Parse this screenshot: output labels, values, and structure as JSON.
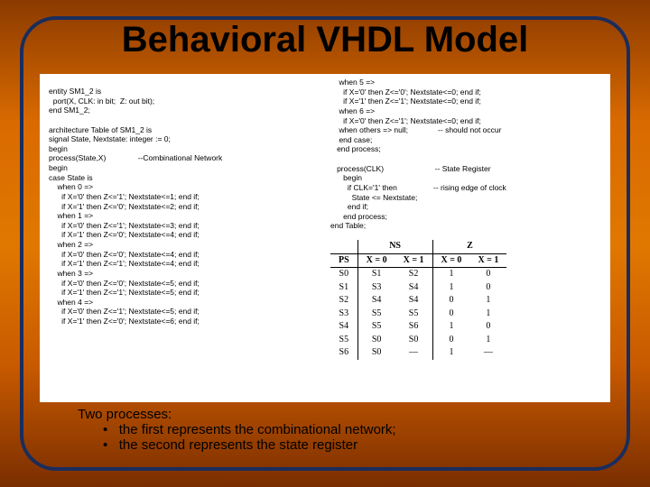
{
  "title": "Behavioral VHDL Model",
  "left_code": "entity SM1_2 is\n  port(X, CLK: in bit;  Z: out bit);\nend SM1_2;\n\narchitecture Table of SM1_2 is\nsignal State, Nextstate: integer := 0;\nbegin\nprocess(State,X)               --Combinational Network\nbegin\ncase State is\n    when 0 =>\n      if X='0' then Z<='1'; Nextstate<=1; end if;\n      if X='1' then Z<='0'; Nextstate<=2; end if;\n    when 1 =>\n      if X='0' then Z<='1'; Nextstate<=3; end if;\n      if X='1' then Z<='0'; Nextstate<=4; end if;\n    when 2 =>\n      if X='0' then Z<='0'; Nextstate<=4; end if;\n      if X='1' then Z<='1'; Nextstate<=4; end if;\n    when 3 =>\n      if X='0' then Z<='0'; Nextstate<=5; end if;\n      if X='1' then Z<='1'; Nextstate<=5; end if;\n    when 4 =>\n      if X='0' then Z<='1'; Nextstate<=5; end if;\n      if X='1' then Z<='0'; Nextstate<=6; end if;",
  "right_code": "    when 5 =>\n      if X='0' then Z<='0'; Nextstate<=0; end if;\n      if X='1' then Z<='1'; Nextstate<=0; end if;\n    when 6 =>\n      if X='0' then Z<='1'; Nextstate<=0; end if;\n    when others => null;              -- should not occur\n    end case;\n   end process;\n\n   process(CLK)                        -- State Register\n      begin\n        if CLK='1' then                 -- rising edge of clock\n          State <= Nextstate;\n        end if;\n      end process;\nend Table;",
  "table": {
    "head_ns": "NS",
    "head_z": "Z",
    "ps": "PS",
    "cols": [
      "X = 0",
      "X = 1",
      "X = 0",
      "X = 1"
    ],
    "rows": [
      [
        "S0",
        "S1",
        "S2",
        "1",
        "0"
      ],
      [
        "S1",
        "S3",
        "S4",
        "1",
        "0"
      ],
      [
        "S2",
        "S4",
        "S4",
        "0",
        "1"
      ],
      [
        "S3",
        "S5",
        "S5",
        "0",
        "1"
      ],
      [
        "S4",
        "S5",
        "S6",
        "1",
        "0"
      ],
      [
        "S5",
        "S0",
        "S0",
        "0",
        "1"
      ],
      [
        "S6",
        "S0",
        "—",
        "1",
        "—"
      ]
    ]
  },
  "notes": {
    "line1": "Two processes:",
    "b1": "the first represents the combinational network;",
    "b2": "the second represents the state register"
  }
}
